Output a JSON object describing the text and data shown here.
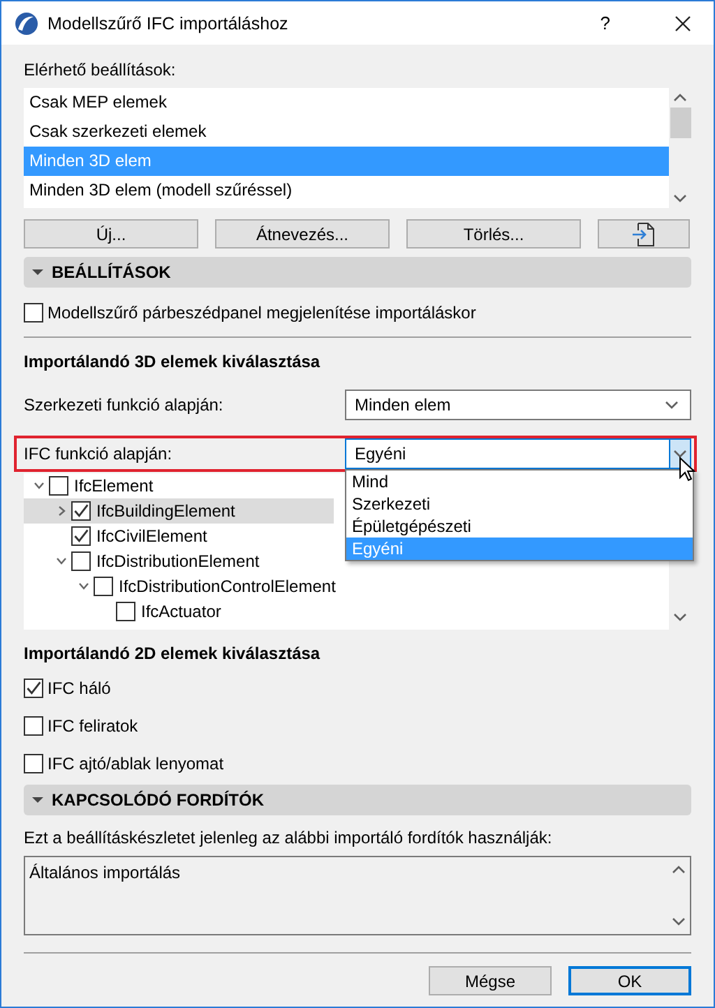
{
  "window": {
    "title": "Modellszűrő IFC importáláshoz",
    "help": "?"
  },
  "presets": {
    "label": "Elérhető beállítások:",
    "items": [
      {
        "label": "Csak MEP elemek",
        "selected": false
      },
      {
        "label": "Csak szerkezeti elemek",
        "selected": false
      },
      {
        "label": "Minden 3D elem",
        "selected": true
      },
      {
        "label": "Minden 3D elem (modell szűréssel)",
        "selected": false
      }
    ]
  },
  "preset_buttons": [
    "Új...",
    "Átnevezés...",
    "Törlés..."
  ],
  "settings": {
    "title": "BEÁLLÍTÁSOK",
    "expanded": true,
    "show_dialog": {
      "label": "Modellszűrő párbeszédpanel megjelenítése importáláskor",
      "checked": false
    }
  },
  "select_3d": {
    "title": "Importálandó 3D elemek kiválasztása",
    "structural": {
      "label": "Szerkezeti funkció alapján:",
      "value": "Minden elem"
    },
    "ifc_function": {
      "label": "IFC funkció alapján:",
      "value": "Egyéni",
      "highlighted": true,
      "open": true,
      "options": [
        {
          "label": "Mind",
          "selected": false
        },
        {
          "label": "Szerkezeti",
          "selected": false
        },
        {
          "label": "Épületgépészeti",
          "selected": false
        },
        {
          "label": "Egyéni",
          "selected": true
        }
      ]
    },
    "tree": [
      {
        "label": "IfcElement",
        "kind": "branch",
        "expanded": true,
        "checked": false,
        "selected": false,
        "children": [
          {
            "label": "IfcBuildingElement",
            "kind": "branch",
            "expanded": false,
            "checked": true,
            "selected": true
          },
          {
            "label": "IfcCivilElement",
            "kind": "leaf",
            "checked": true,
            "selected": false
          },
          {
            "label": "IfcDistributionElement",
            "kind": "branch",
            "expanded": true,
            "checked": false,
            "selected": false,
            "children": [
              {
                "label": "IfcDistributionControlElement",
                "kind": "branch",
                "expanded": true,
                "checked": false,
                "selected": false,
                "children": [
                  {
                    "label": "IfcActuator",
                    "kind": "leaf",
                    "checked": false,
                    "selected": false
                  }
                ]
              }
            ]
          }
        ]
      }
    ]
  },
  "select_2d": {
    "title": "Importálandó 2D elemek kiválasztása",
    "items": [
      {
        "label": "IFC háló",
        "checked": true
      },
      {
        "label": "IFC feliratok",
        "checked": false
      },
      {
        "label": "IFC ajtó/ablak lenyomat",
        "checked": false
      }
    ]
  },
  "translators": {
    "title": "KAPCSOLÓDÓ FORDÍTÓK",
    "expanded": true,
    "description": "Ezt a beállításkészletet jelenleg az alábbi importáló fordítók használják:",
    "items": [
      "Általános importálás"
    ]
  },
  "footer": {
    "cancel": "Mégse",
    "ok": "OK"
  }
}
